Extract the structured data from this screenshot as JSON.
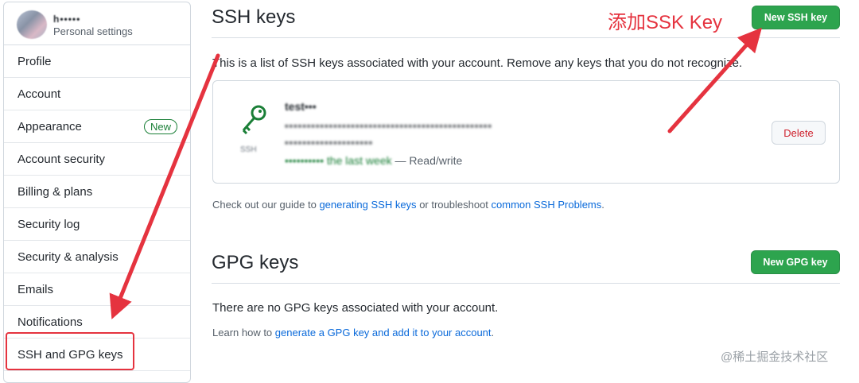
{
  "sidebar": {
    "username": "h•••••",
    "subtitle": "Personal settings",
    "items": [
      {
        "label": "Profile"
      },
      {
        "label": "Account"
      },
      {
        "label": "Appearance",
        "badge": "New"
      },
      {
        "label": "Account security"
      },
      {
        "label": "Billing & plans"
      },
      {
        "label": "Security log"
      },
      {
        "label": "Security & analysis"
      },
      {
        "label": "Emails"
      },
      {
        "label": "Notifications"
      },
      {
        "label": "SSH and GPG keys"
      }
    ]
  },
  "ssh": {
    "title": "SSH keys",
    "new_button": "New SSH key",
    "description": "This is a list of SSH keys associated with your account. Remove any keys that you do not recognize.",
    "key": {
      "type_label": "SSH",
      "title": "test•••",
      "fingerprint": "•••••••••••••••••••••••••••••••••••••••••••••••",
      "added": "••••••••••••••••••••",
      "last_used_prefix": "•••••••••• the last week",
      "access": "— Read/write",
      "delete_label": "Delete"
    },
    "guide_prefix": "Check out our guide to",
    "guide_link1": "generating SSH keys",
    "guide_middle": "or troubleshoot",
    "guide_link2": "common SSH Problems",
    "guide_suffix": "."
  },
  "gpg": {
    "title": "GPG keys",
    "new_button": "New GPG key",
    "empty_text": "There are no GPG keys associated with your account.",
    "learn_prefix": "Learn how to",
    "learn_link": "generate a GPG key and add it to your account",
    "learn_suffix": "."
  },
  "annotation": {
    "text": "添加SSK Key",
    "color": "#e5333f"
  },
  "watermark": "@稀土掘金技术社区",
  "colors": {
    "accent_green": "#2da44e",
    "link_blue": "#0969da",
    "danger_red": "#cf222e",
    "annotation_red": "#e5333f"
  }
}
